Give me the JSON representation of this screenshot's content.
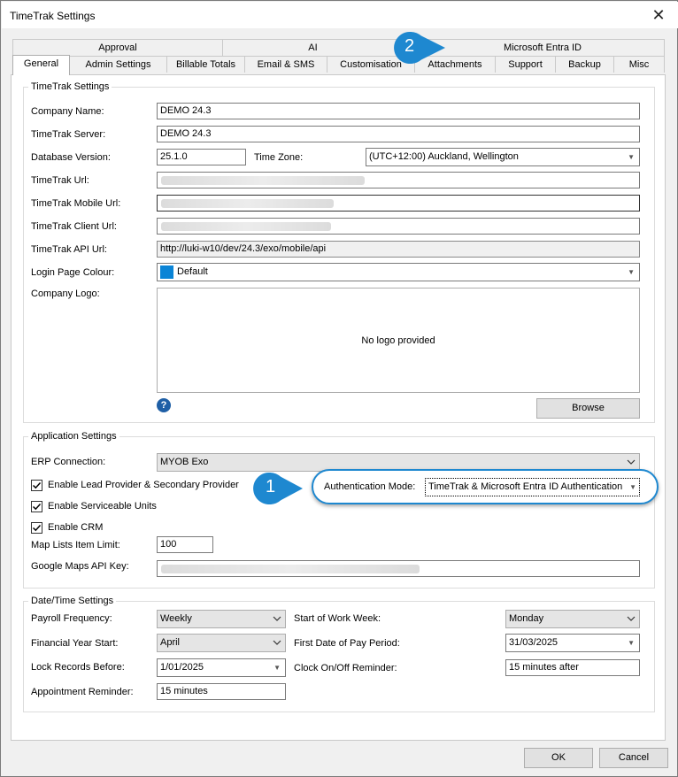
{
  "window": {
    "title": "TimeTrak Settings"
  },
  "tabs_back": [
    "Approval",
    "AI",
    "Microsoft Entra ID"
  ],
  "tabs_front": [
    "General",
    "Admin Settings",
    "Billable Totals",
    "Email & SMS",
    "Customisation",
    "Attachments",
    "Support",
    "Backup",
    "Misc"
  ],
  "callouts": {
    "one": "1",
    "two": "2"
  },
  "timetrak_settings": {
    "group_label": "TimeTrak Settings",
    "company_name_label": "Company Name:",
    "company_name": "DEMO 24.3",
    "server_label": "TimeTrak Server:",
    "server": "DEMO 24.3",
    "db_version_label": "Database Version:",
    "db_version": "25.1.0",
    "time_zone_label": "Time Zone:",
    "time_zone": "(UTC+12:00) Auckland, Wellington",
    "url_label": "TimeTrak Url:",
    "mobile_url_label": "TimeTrak Mobile Url:",
    "client_url_label": "TimeTrak Client Url:",
    "api_url_label": "TimeTrak API Url:",
    "api_url": "http://luki-w10/dev/24.3/exo/mobile/api",
    "login_colour_label": "Login Page Colour:",
    "login_colour": "Default",
    "login_colour_swatch": "#0a84d6",
    "logo_label": "Company Logo:",
    "logo_placeholder": "No logo provided",
    "help_icon": "?",
    "browse": "Browse"
  },
  "app_settings": {
    "group_label": "Application Settings",
    "erp_label": "ERP Connection:",
    "erp": "MYOB Exo",
    "lead_provider": "Enable Lead Provider & Secondary Provider",
    "serviceable_units": "Enable Serviceable Units",
    "crm": "Enable CRM",
    "auth_mode_label": "Authentication Mode:",
    "auth_mode": "TimeTrak & Microsoft Entra ID Authentication",
    "map_limit_label": "Map Lists Item Limit:",
    "map_limit": "100",
    "maps_key_label": "Google Maps API Key:"
  },
  "datetime_settings": {
    "group_label": "Date/Time Settings",
    "payroll_label": "Payroll Frequency:",
    "payroll": "Weekly",
    "fy_start_label": "Financial Year Start:",
    "fy_start": "April",
    "lock_label": "Lock Records Before:",
    "lock": "1/01/2025",
    "appt_label": "Appointment Reminder:",
    "appt": "15 minutes",
    "work_week_label": "Start of Work Week:",
    "work_week": "Monday",
    "pay_period_label": "First Date of Pay Period:",
    "pay_period": "31/03/2025",
    "clock_label": "Clock On/Off Reminder:",
    "clock": "15 minutes after"
  },
  "footer": {
    "ok": "OK",
    "cancel": "Cancel"
  },
  "colors": {
    "callout": "#1e88d0"
  }
}
